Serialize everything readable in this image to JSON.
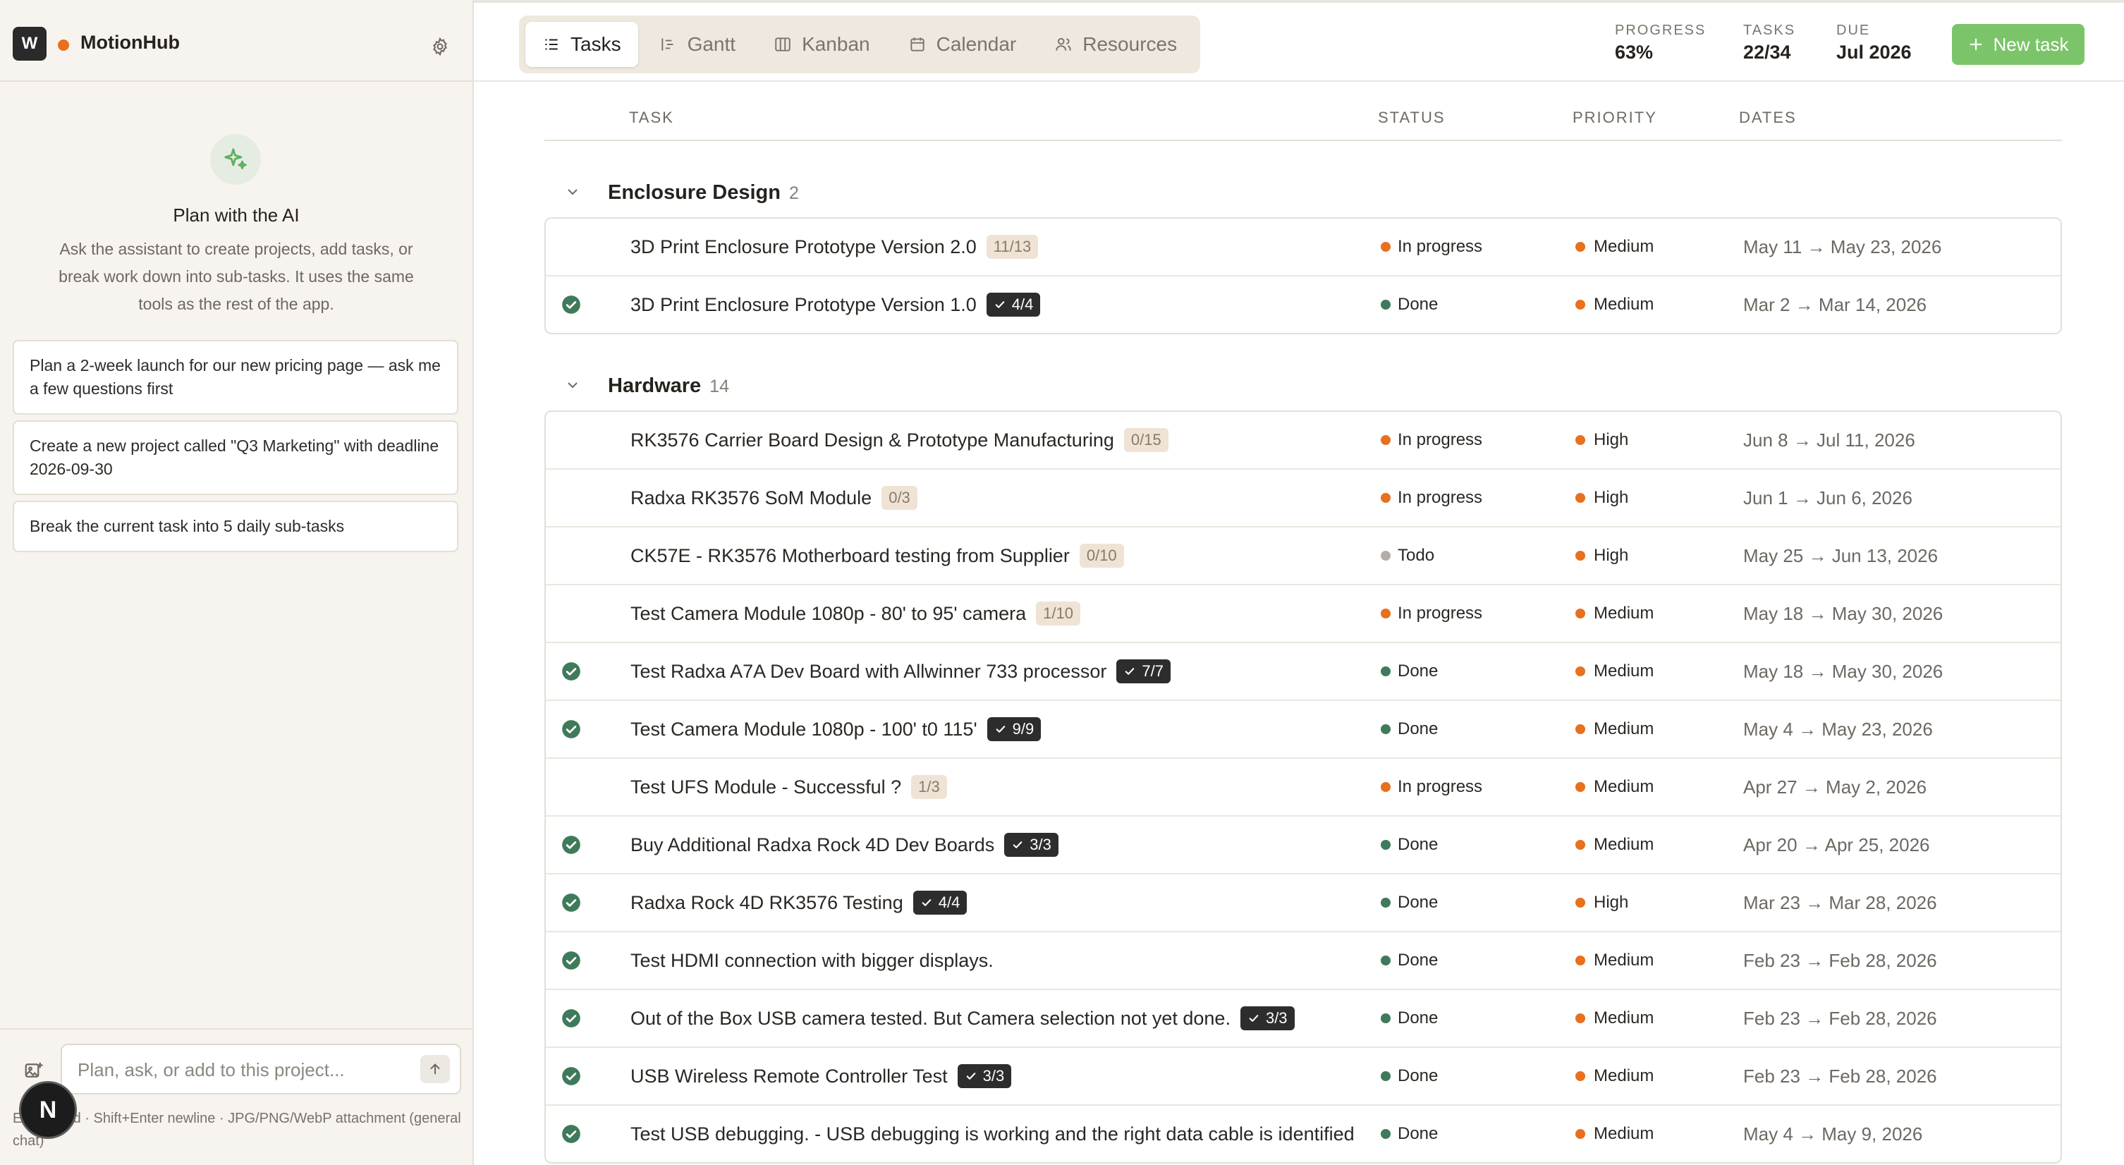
{
  "app": {
    "workspace_initial": "W",
    "name": "MotionHub"
  },
  "assistant": {
    "title": "Plan with the AI",
    "description": "Ask the assistant to create projects, add tasks, or break work down into sub-tasks. It uses the same tools as the rest of the app.",
    "suggestions": [
      "Plan a 2-week launch for our new pricing page — ask me a few questions first",
      "Create a new project called \"Q3 Marketing\" with deadline 2026-09-30",
      "Break the current task into 5 daily sub-tasks"
    ],
    "input_placeholder": "Plan, ask, or add to this project...",
    "hint": "Enter send · Shift+Enter newline · JPG/PNG/WebP attachment (general chat)",
    "user_initial": "N"
  },
  "views": [
    "Tasks",
    "Gantt",
    "Kanban",
    "Calendar",
    "Resources"
  ],
  "active_view": "Tasks",
  "metrics": {
    "progress_label": "PROGRESS",
    "progress_value": "63%",
    "tasks_label": "TASKS",
    "tasks_value": "22/34",
    "due_label": "DUE",
    "due_value": "Jul 2026"
  },
  "new_task_label": "New task",
  "columns": {
    "task": "TASK",
    "status": "STATUS",
    "priority": "PRIORITY",
    "dates": "DATES"
  },
  "colors": {
    "in_progress": "#e8701f",
    "done": "#3f7a5a",
    "todo": "#b3aea8",
    "priority": "#e8701f",
    "accent": "#7bc46a"
  },
  "groups": [
    {
      "name": "Enclosure Design",
      "count": "2",
      "rows": [
        {
          "done": false,
          "name": "3D Print Enclosure Prototype Version 2.0",
          "badge": "11/13",
          "badge_complete": false,
          "status": "In progress",
          "status_key": "in_progress",
          "priority": "Medium",
          "dates": "May 11 → May 23, 2026"
        },
        {
          "done": true,
          "name": "3D Print Enclosure Prototype Version 1.0",
          "badge": "4/4",
          "badge_complete": true,
          "status": "Done",
          "status_key": "done",
          "priority": "Medium",
          "dates": "Mar 2 → Mar 14, 2026"
        }
      ]
    },
    {
      "name": "Hardware",
      "count": "14",
      "rows": [
        {
          "done": false,
          "name": "RK3576 Carrier Board Design & Prototype Manufacturing",
          "badge": "0/15",
          "badge_complete": false,
          "status": "In progress",
          "status_key": "in_progress",
          "priority": "High",
          "dates": "Jun 8 → Jul 11, 2026"
        },
        {
          "done": false,
          "name": "Radxa RK3576 SoM Module",
          "badge": "0/3",
          "badge_complete": false,
          "status": "In progress",
          "status_key": "in_progress",
          "priority": "High",
          "dates": "Jun 1 → Jun 6, 2026"
        },
        {
          "done": false,
          "name": "CK57E - RK3576 Motherboard testing from Supplier",
          "badge": "0/10",
          "badge_complete": false,
          "status": "Todo",
          "status_key": "todo",
          "priority": "High",
          "dates": "May 25 → Jun 13, 2026"
        },
        {
          "done": false,
          "name": "Test Camera Module 1080p - 80' to 95' camera",
          "badge": "1/10",
          "badge_complete": false,
          "status": "In progress",
          "status_key": "in_progress",
          "priority": "Medium",
          "dates": "May 18 → May 30, 2026"
        },
        {
          "done": true,
          "name": "Test Radxa A7A Dev Board with Allwinner 733 processor",
          "badge": "7/7",
          "badge_complete": true,
          "status": "Done",
          "status_key": "done",
          "priority": "Medium",
          "dates": "May 18 → May 30, 2026"
        },
        {
          "done": true,
          "name": "Test Camera Module 1080p - 100' t0 115'",
          "badge": "9/9",
          "badge_complete": true,
          "status": "Done",
          "status_key": "done",
          "priority": "Medium",
          "dates": "May 4 → May 23, 2026"
        },
        {
          "done": false,
          "name": "Test UFS Module - Successful ?",
          "badge": "1/3",
          "badge_complete": false,
          "status": "In progress",
          "status_key": "in_progress",
          "priority": "Medium",
          "dates": "Apr 27 → May 2, 2026"
        },
        {
          "done": true,
          "name": "Buy Additional Radxa Rock 4D Dev Boards",
          "badge": "3/3",
          "badge_complete": true,
          "status": "Done",
          "status_key": "done",
          "priority": "Medium",
          "dates": "Apr 20 → Apr 25, 2026"
        },
        {
          "done": true,
          "name": "Radxa Rock 4D RK3576 Testing",
          "badge": "4/4",
          "badge_complete": true,
          "status": "Done",
          "status_key": "done",
          "priority": "High",
          "dates": "Mar 23 → Mar 28, 2026"
        },
        {
          "done": true,
          "name": "Test HDMI connection with bigger displays.",
          "badge": "",
          "badge_complete": false,
          "status": "Done",
          "status_key": "done",
          "priority": "Medium",
          "dates": "Feb 23 → Feb 28, 2026"
        },
        {
          "done": true,
          "name": "Out of the Box USB camera tested. But Camera selection not yet done.",
          "badge": "3/3",
          "badge_complete": true,
          "status": "Done",
          "status_key": "done",
          "priority": "Medium",
          "dates": "Feb 23 → Feb 28, 2026"
        },
        {
          "done": true,
          "name": "USB Wireless Remote Controller Test",
          "badge": "3/3",
          "badge_complete": true,
          "status": "Done",
          "status_key": "done",
          "priority": "Medium",
          "dates": "Feb 23 → Feb 28, 2026"
        },
        {
          "done": true,
          "name": "Test USB debugging. - USB debugging is working and the right data cable is identified",
          "badge": "",
          "badge_complete": false,
          "status": "Done",
          "status_key": "done",
          "priority": "Medium",
          "dates": "May 4 → May 9, 2026"
        }
      ]
    }
  ]
}
